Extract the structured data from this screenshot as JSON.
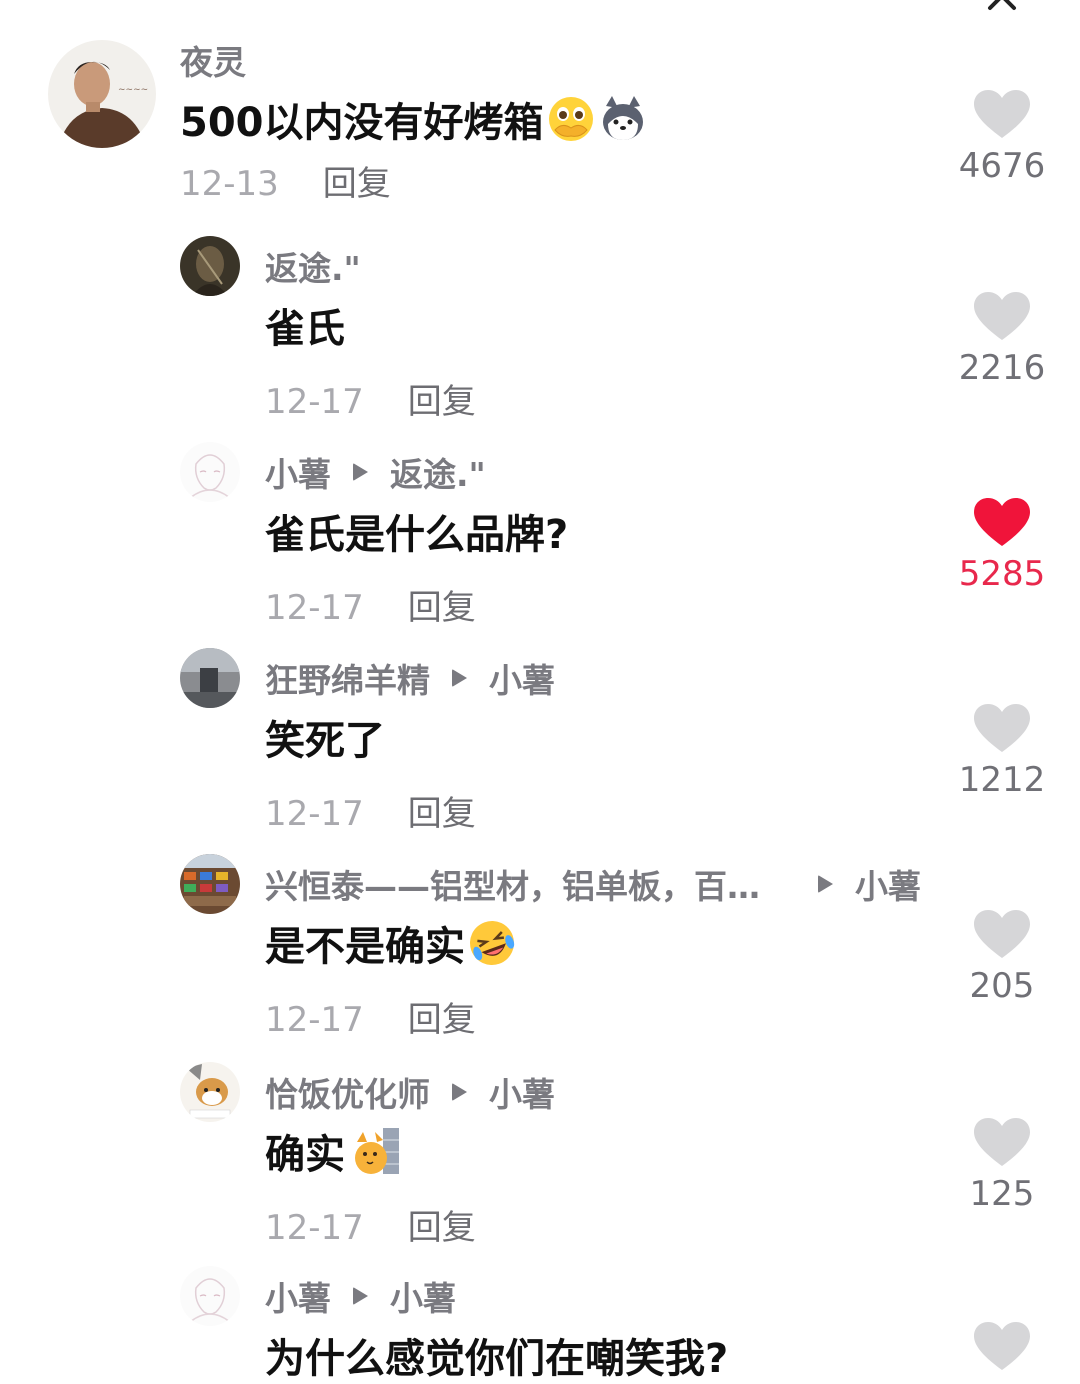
{
  "comments": [
    {
      "username": "夜灵",
      "content": "500以内没有好烤箱",
      "emojis": [
        "pleading-covering-mouth-emoji",
        "husky-dog-emoji"
      ],
      "date": "12-13",
      "reply_label": "回复",
      "likes": "4676",
      "liked": false
    },
    {
      "username": "返途.\"",
      "content": "雀氏",
      "date": "12-17",
      "reply_label": "回复",
      "likes": "2216",
      "liked": false
    },
    {
      "username": "小薯",
      "reply_to": "返途.\"",
      "content": "雀氏是什么品牌?",
      "date": "12-17",
      "reply_label": "回复",
      "likes": "5285",
      "liked": true
    },
    {
      "username": "狂野绵羊精",
      "reply_to": "小薯",
      "content": "笑死了",
      "date": "12-17",
      "reply_label": "回复",
      "likes": "1212",
      "liked": false
    },
    {
      "username": "兴恒泰——铝型材，铝单板，百…",
      "reply_to": "小薯",
      "content": "是不是确实",
      "emojis": [
        "rolling-laughing-emoji"
      ],
      "date": "12-17",
      "reply_label": "回复",
      "likes": "205",
      "liked": false
    },
    {
      "username": "恰饭优化师",
      "reply_to": "小薯",
      "content": "确实",
      "emojis": [
        "cat-peeking-wall-emoji"
      ],
      "date": "12-17",
      "reply_label": "回复",
      "likes": "125",
      "liked": false
    },
    {
      "username": "小薯",
      "reply_to": "小薯",
      "content": "为什么感觉你们在嘲笑我?",
      "liked": false
    }
  ],
  "colors": {
    "liked": "#e8284c",
    "heart_inactive": "#d6d6d8",
    "username": "#7a7a80",
    "meta": "#a9a9ae"
  }
}
